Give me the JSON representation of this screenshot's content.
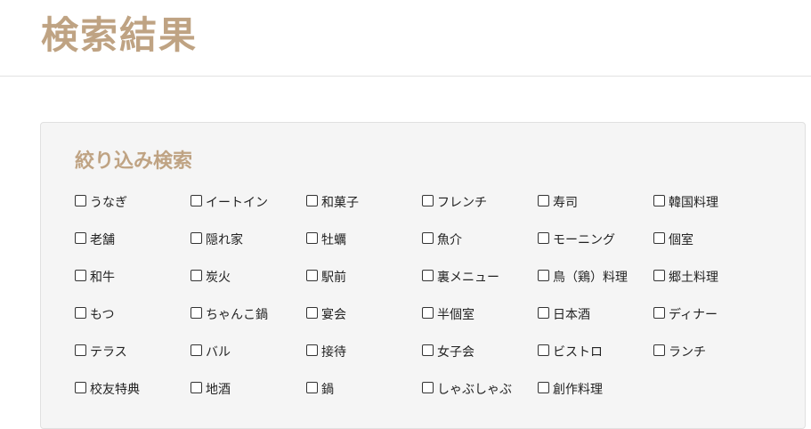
{
  "page": {
    "title": "検索結果"
  },
  "filter": {
    "title": "絞り込み検索",
    "options": [
      {
        "label": "うなぎ",
        "checked": false
      },
      {
        "label": "イートイン",
        "checked": false
      },
      {
        "label": "和菓子",
        "checked": false
      },
      {
        "label": "フレンチ",
        "checked": false
      },
      {
        "label": "寿司",
        "checked": false
      },
      {
        "label": "韓国料理",
        "checked": false
      },
      {
        "label": "老舗",
        "checked": false
      },
      {
        "label": "隠れ家",
        "checked": false
      },
      {
        "label": "牡蠣",
        "checked": false
      },
      {
        "label": "魚介",
        "checked": false
      },
      {
        "label": "モーニング",
        "checked": false
      },
      {
        "label": "個室",
        "checked": false
      },
      {
        "label": "和牛",
        "checked": false
      },
      {
        "label": "炭火",
        "checked": false
      },
      {
        "label": "駅前",
        "checked": false
      },
      {
        "label": "裏メニュー",
        "checked": false
      },
      {
        "label": "鳥（鶏）料理",
        "checked": false
      },
      {
        "label": "郷土料理",
        "checked": false
      },
      {
        "label": "もつ",
        "checked": false
      },
      {
        "label": "ちゃんこ鍋",
        "checked": false
      },
      {
        "label": "宴会",
        "checked": false
      },
      {
        "label": "半個室",
        "checked": false
      },
      {
        "label": "日本酒",
        "checked": false
      },
      {
        "label": "ディナー",
        "checked": false
      },
      {
        "label": "テラス",
        "checked": false
      },
      {
        "label": "バル",
        "checked": false
      },
      {
        "label": "接待",
        "checked": false
      },
      {
        "label": "女子会",
        "checked": false
      },
      {
        "label": "ビストロ",
        "checked": false
      },
      {
        "label": "ランチ",
        "checked": false
      },
      {
        "label": "校友特典",
        "checked": false
      },
      {
        "label": "地酒",
        "checked": false
      },
      {
        "label": "鍋",
        "checked": false
      },
      {
        "label": "しゃぶしゃぶ",
        "checked": false
      },
      {
        "label": "創作料理",
        "checked": false
      }
    ]
  }
}
